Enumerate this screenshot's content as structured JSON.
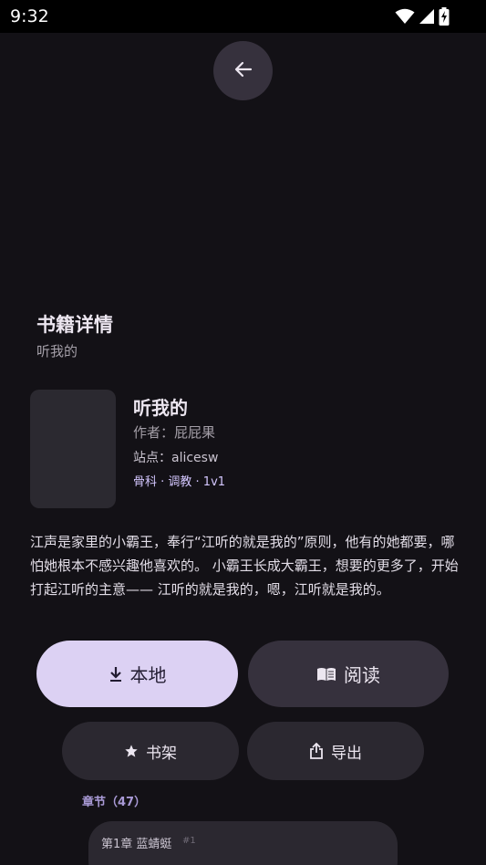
{
  "status_bar": {
    "time": "9:32",
    "icons": [
      "wifi-icon",
      "signal-icon",
      "battery-charging-icon"
    ]
  },
  "header": {
    "title": "书籍详情",
    "subtitle": "听我的"
  },
  "book": {
    "title": "听我的",
    "author": "作者：屁屁果",
    "site": "站点：alicesw",
    "tags": "骨科 · 调教 · 1v1",
    "description": "江声是家里的小霸王，奉行“江听的就是我的”原则，他有的她都要，哪怕她根本不感兴趣他喜欢的。 小霸王长成大霸王，想要的更多了，开始打起江听的主意—— 江听的就是我的，嗯，江听就是我的。"
  },
  "actions": {
    "local_label": "本地",
    "read_label": "阅读",
    "shelf_label": "书架",
    "export_label": "导出"
  },
  "chapters": {
    "label": "章节（47）",
    "items": [
      {
        "title": "第1章 蓝蜻蜓",
        "num": "#1"
      }
    ]
  },
  "colors": {
    "background": "#131116",
    "primary_button": "#dcd1f3",
    "tonal_button": "#36313d",
    "accent_text": "#d4c7ff"
  }
}
